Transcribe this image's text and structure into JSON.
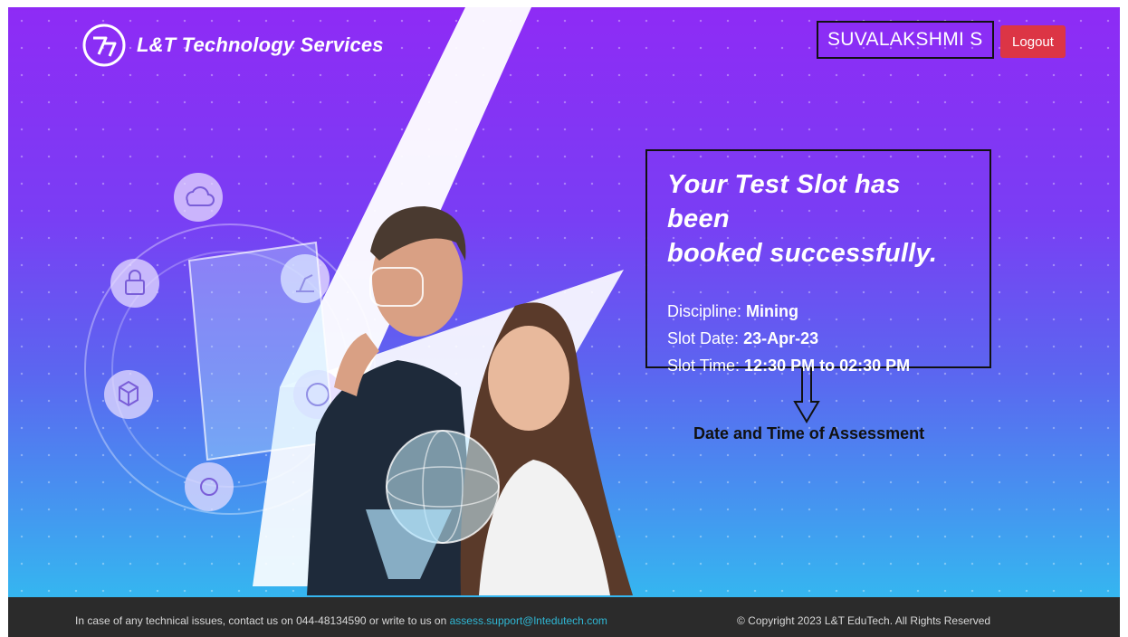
{
  "header": {
    "brand": "L&T Technology Services",
    "user_name": "SUVALAKSHMI S",
    "logout_label": "Logout"
  },
  "confirmation": {
    "title_line1": "Your Test Slot has been",
    "title_line2": "booked successfully.",
    "discipline_label": "Discipline:",
    "discipline_value": "Mining",
    "date_label": "Slot Date:",
    "date_value": "23-Apr-23",
    "time_label": "Slot Time:",
    "time_value": "12:30 PM to 02:30 PM"
  },
  "annotation": {
    "text": "Date and Time of Assessment"
  },
  "footer": {
    "support_text": "In case of any technical issues, contact us on 044-48134590 or write to us on",
    "support_email": "assess.support@lntedutech.com",
    "copyright": "© Copyright 2023 L&T EduTech. All Rights Reserved"
  },
  "colors": {
    "logout_bg": "#dc3545",
    "footer_bg": "#2b2b2b",
    "link": "#2fb7d4",
    "gradient_top": "#8e2bf5",
    "gradient_bottom": "#35b6f0"
  }
}
